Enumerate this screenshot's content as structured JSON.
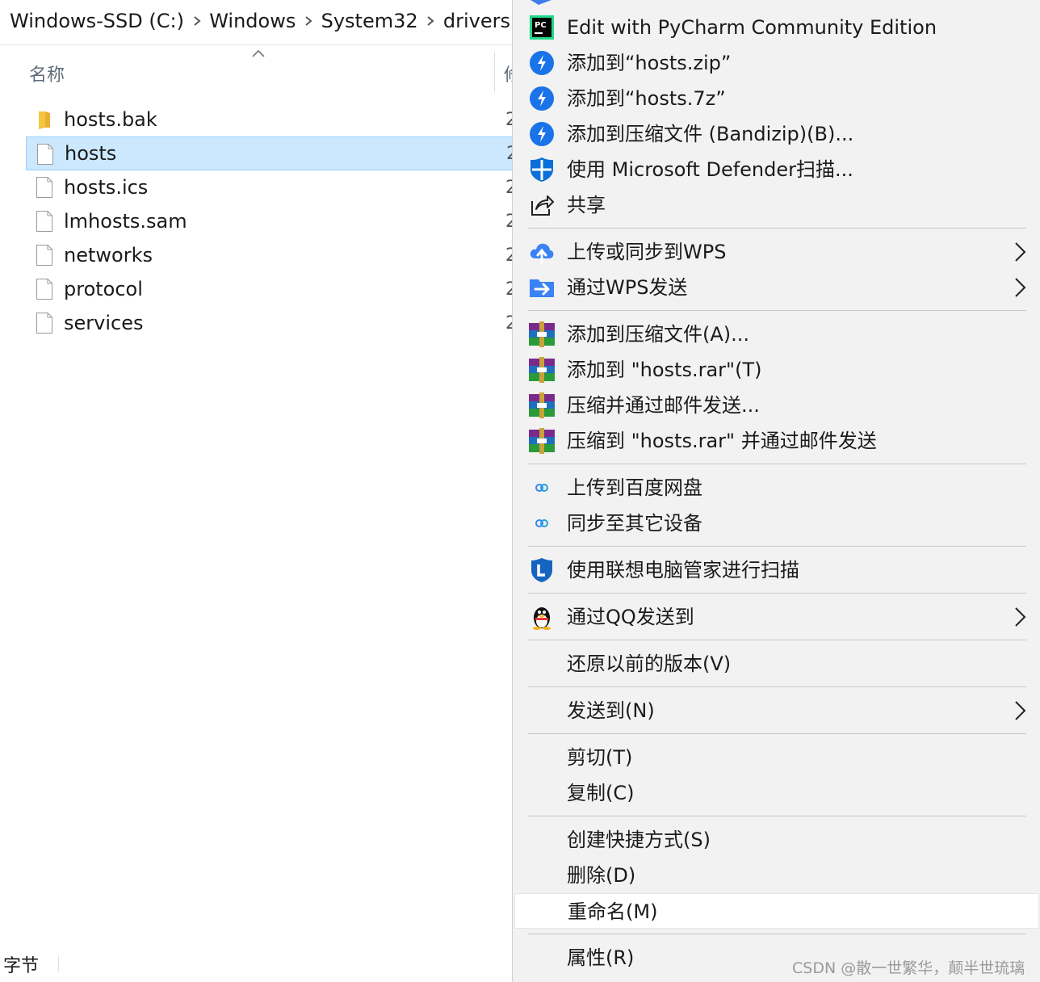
{
  "breadcrumb": [
    "Windows-SSD (C:)",
    "Windows",
    "System32",
    "drivers"
  ],
  "file_list": {
    "column_name": "名称",
    "column_next_fragment": "修",
    "files": [
      {
        "name": "hosts.bak",
        "type": "folder",
        "date_fragment": "2"
      },
      {
        "name": "hosts",
        "type": "file",
        "selected": true,
        "date_fragment": "2"
      },
      {
        "name": "hosts.ics",
        "type": "file",
        "date_fragment": "2"
      },
      {
        "name": "lmhosts.sam",
        "type": "file",
        "date_fragment": "2"
      },
      {
        "name": "networks",
        "type": "file",
        "date_fragment": "2"
      },
      {
        "name": "protocol",
        "type": "file",
        "date_fragment": "2"
      },
      {
        "name": "services",
        "type": "file",
        "date_fragment": "2"
      }
    ]
  },
  "status_bar": {
    "text": "字节"
  },
  "context_menu": {
    "items": [
      {
        "label": "Edit with PyCharm Community Edition",
        "icon": "pycharm-icon"
      },
      {
        "label": "添加到“hosts.zip”",
        "icon": "bandizip-icon"
      },
      {
        "label": "添加到“hosts.7z”",
        "icon": "bandizip-icon"
      },
      {
        "label": "添加到压缩文件 (Bandizip)(B)...",
        "icon": "bandizip-icon"
      },
      {
        "label": "使用 Microsoft Defender扫描...",
        "icon": "defender-shield-icon"
      },
      {
        "label": "共享",
        "icon": "share-icon"
      },
      {
        "label": "上传或同步到WPS",
        "icon": "wps-cloud-upload-icon",
        "submenu": true
      },
      {
        "label": "通过WPS发送",
        "icon": "wps-send-icon",
        "submenu": true
      },
      {
        "label": "添加到压缩文件(A)...",
        "icon": "winrar-icon"
      },
      {
        "label": "添加到 \"hosts.rar\"(T)",
        "icon": "winrar-icon"
      },
      {
        "label": "压缩并通过邮件发送...",
        "icon": "winrar-icon"
      },
      {
        "label": "压缩到 \"hosts.rar\" 并通过邮件发送",
        "icon": "winrar-icon"
      },
      {
        "label": "上传到百度网盘",
        "icon": "baidu-netdisk-icon"
      },
      {
        "label": "同步至其它设备",
        "icon": "baidu-netdisk-icon"
      },
      {
        "label": "使用联想电脑管家进行扫描",
        "icon": "lenovo-shield-icon"
      },
      {
        "label": "通过QQ发送到",
        "icon": "qq-penguin-icon",
        "submenu": true
      },
      {
        "label": "还原以前的版本(V)"
      },
      {
        "label": "发送到(N)",
        "submenu": true
      },
      {
        "label": "剪切(T)"
      },
      {
        "label": "复制(C)"
      },
      {
        "label": "创建快捷方式(S)"
      },
      {
        "label": "删除(D)"
      },
      {
        "label": "重命名(M)",
        "hovered": true
      },
      {
        "label": "属性(R)"
      }
    ]
  },
  "watermark": "CSDN @散一世繁华，颠半世琉璃",
  "colors": {
    "selection": "#cce8ff",
    "menu_bg": "#f2f2f2",
    "bandizip_blue": "#1a73e8",
    "wps_blue": "#3b82f6"
  }
}
